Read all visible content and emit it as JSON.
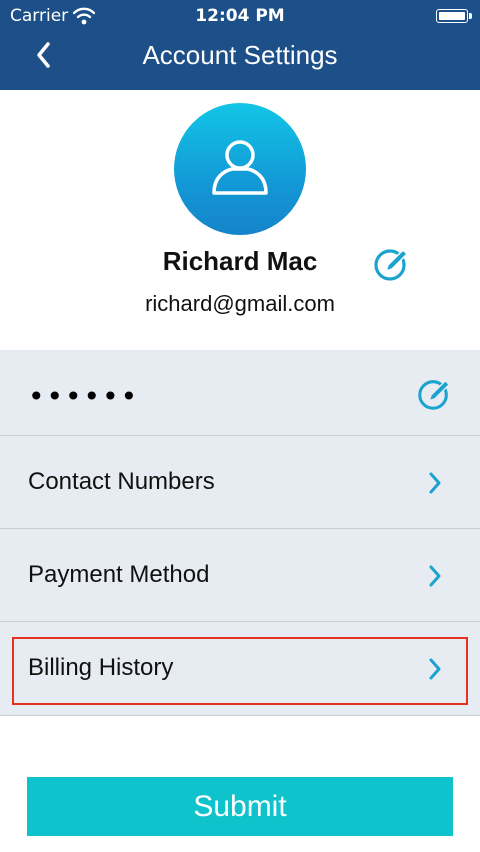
{
  "status_bar": {
    "carrier": "Carrier",
    "time": "12:04 PM"
  },
  "nav": {
    "title": "Account Settings",
    "back_icon": "chevron-left-icon"
  },
  "profile": {
    "name": "Richard Mac",
    "email": "richard@gmail.com",
    "avatar_icon": "user-icon",
    "edit_icon": "edit-icon"
  },
  "settings": {
    "password_mask": "••••••",
    "items": [
      {
        "label": "Contact Numbers"
      },
      {
        "label": "Payment Method"
      },
      {
        "label": "Billing History"
      }
    ]
  },
  "actions": {
    "submit_label": "Submit"
  },
  "colors": {
    "nav_bg": "#1d4f88",
    "list_bg": "#e7ebf2",
    "accent": "#1aa3cf",
    "submit_bg": "#0fc3cc",
    "highlight": "#e5321e"
  }
}
